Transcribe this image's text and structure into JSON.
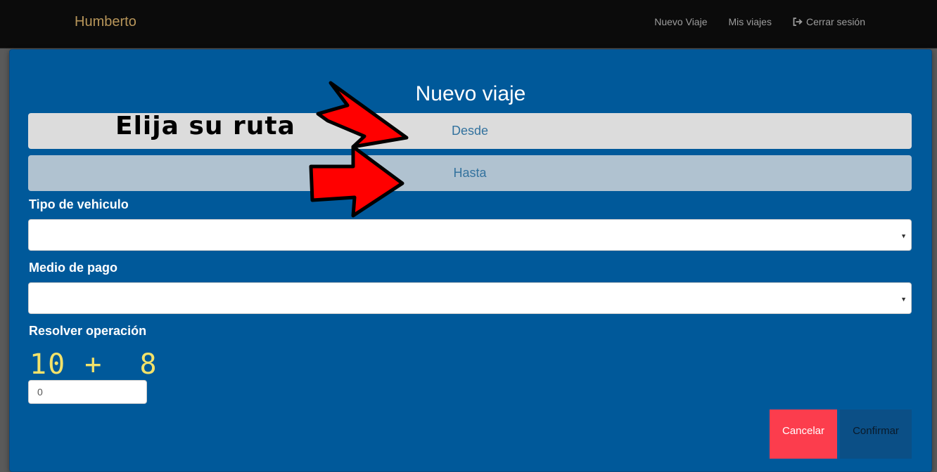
{
  "navbar": {
    "brand": "Humberto",
    "links": {
      "new_trip": "Nuevo Viaje",
      "my_trips": "Mis viajes",
      "logout": "Cerrar sesión"
    }
  },
  "modal": {
    "title": "Nuevo viaje",
    "annotation": "Elija su ruta",
    "route_from": "Desde",
    "route_to": "Hasta",
    "vehicle_type_label": "Tipo de vehiculo",
    "vehicle_type_value": "",
    "payment_label": "Medio de pago",
    "payment_value": "",
    "captcha_label": "Resolver operación",
    "captcha_expression": "10 +  8",
    "captcha_answer": "0",
    "cancel_label": "Cancelar",
    "confirm_label": "Confirmar"
  },
  "colors": {
    "navbar_bg": "#0b0b0b",
    "brand": "#b8965a",
    "modal_bg": "#00599a",
    "captcha": "#f2e26a",
    "cancel": "#fc3d4d",
    "confirm": "#0b4f86",
    "annotation_arrow": "#ff0000"
  },
  "icons": {
    "logout": "sign-out-icon",
    "annotation": "red-arrow-icon"
  }
}
